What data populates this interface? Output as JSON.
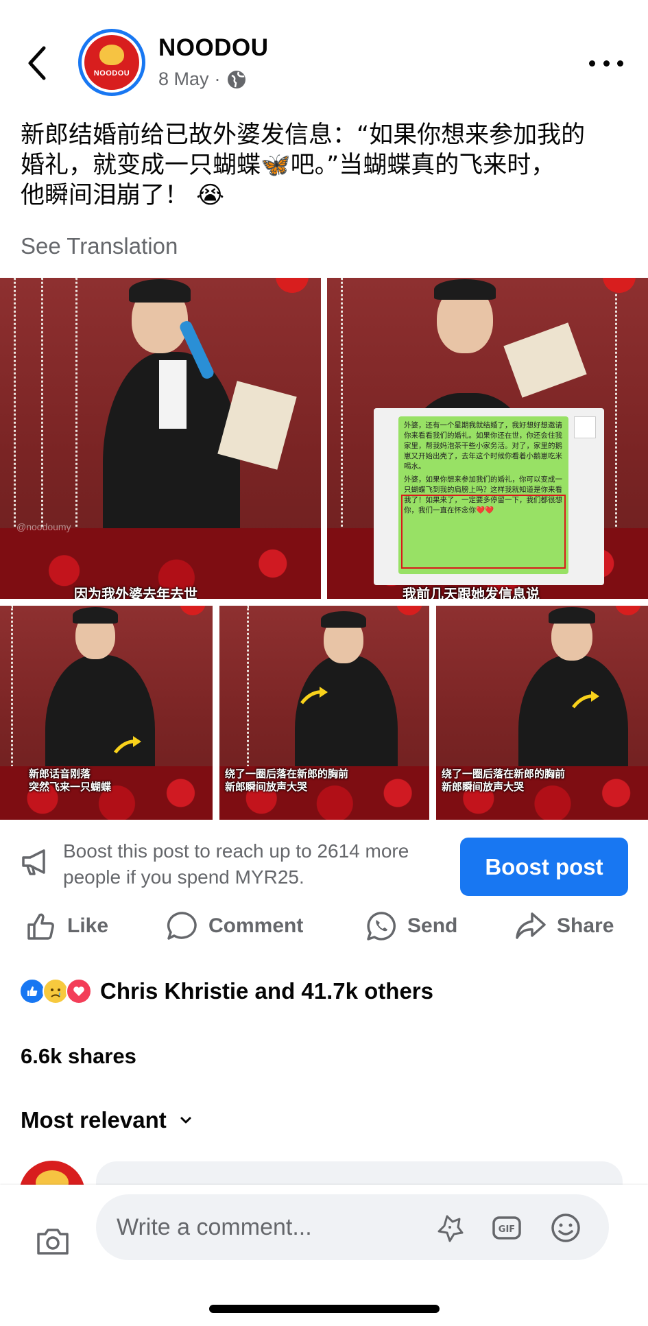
{
  "header": {
    "page_name": "NOODOU",
    "date": "8 May",
    "separator": "·",
    "logo_text": "NOODOU"
  },
  "post": {
    "caption_line1": "新郎结婚前给已故外婆发信息：“如果你想来参加我的",
    "caption_line2": "婚礼，就变成一只蝴蝶🦋吧。”当蝴蝶真的飞来时，",
    "caption_line3": "他瞬间泪崩了！ 😭",
    "see_translation": "See Translation"
  },
  "photos": {
    "photo1_subtitle": "因为我外婆去年去世",
    "photo2_subtitle": "我前几天跟她发信息说",
    "photo3_subtitle_line1": "新郎话音刚落",
    "photo3_subtitle_line2": "突然飞来一只蝴蝶",
    "photo4_subtitle_line1": "绕了一圈后落在新郎的胸前",
    "photo4_subtitle_line2": "新郎瞬间放声大哭",
    "photo5_subtitle_line1": "绕了一圈后落在新郎的胸前",
    "photo5_subtitle_line2": "新郎瞬间放声大哭",
    "watermark": "@noodoumy",
    "chat_text": "外婆，还有一个星期我就结婚了，我好想好想邀请你来看看我们的婚礼。如果你还在世，你还会住我家里，帮我妈泡茶干些小家务活。对了，家里的鹅崽又开始出壳了，去年这个时候你看着小鹅崽吃米喝水。",
    "chat_highlight_text": "外婆，如果你想来参加我们的婚礼，你可以变成一只蝴蝶飞到我的肩膀上吗？这样我就知道是你来看我了！如果来了，一定要多停留一下，我们都很想你，我们一直在怀念你❤️❤️"
  },
  "boost": {
    "text": "Boost this post to reach up to 2614 more people if you spend MYR25.",
    "button_label": "Boost post"
  },
  "actions": {
    "like": "Like",
    "comment": "Comment",
    "send": "Send",
    "share": "Share"
  },
  "reactions": {
    "summary": "Chris Khristie and 41.7k others"
  },
  "shares": "6.6k shares",
  "sort": {
    "label": "Most relevant"
  },
  "composer": {
    "placeholder": "Write a comment..."
  },
  "colors": {
    "brand_blue": "#1877f2",
    "secondary_text": "#65676b",
    "noodou_red": "#d81e1e"
  }
}
